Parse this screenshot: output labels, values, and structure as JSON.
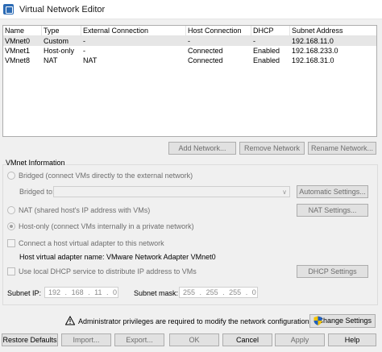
{
  "window": {
    "title": "Virtual Network Editor"
  },
  "table": {
    "columns": [
      "Name",
      "Type",
      "External Connection",
      "Host Connection",
      "DHCP",
      "Subnet Address"
    ],
    "rows": [
      [
        "VMnet0",
        "Custom",
        "-",
        "-",
        "-",
        "192.168.11.0"
      ],
      [
        "VMnet1",
        "Host-only",
        "-",
        "Connected",
        "Enabled",
        "192.168.233.0"
      ],
      [
        "VMnet8",
        "NAT",
        "NAT",
        "Connected",
        "Enabled",
        "192.168.31.0"
      ]
    ]
  },
  "network_buttons": {
    "add": "Add Network...",
    "remove": "Remove Network",
    "rename": "Rename Network..."
  },
  "vmnet_info": {
    "title": "VMnet Information",
    "bridged": {
      "label": "Bridged (connect VMs directly to the external network)",
      "checked": false
    },
    "bridged_to_label": "Bridged to:",
    "bridged_to_value": "",
    "automatic_settings": "Automatic Settings...",
    "nat": {
      "label": "NAT (shared host's IP address with VMs)",
      "checked": false
    },
    "nat_settings": "NAT Settings...",
    "hostonly": {
      "label": "Host-only (connect VMs internally in a private network)",
      "checked": true
    },
    "connect_adapter": {
      "label": "Connect a host virtual adapter to this network",
      "checked": false
    },
    "adapter_name": "Host virtual adapter name: VMware Network Adapter VMnet0",
    "dhcp": {
      "label": "Use local DHCP service to distribute IP address to VMs",
      "checked": false
    },
    "dhcp_settings": "DHCP Settings",
    "subnet_ip_label": "Subnet IP:",
    "subnet_ip": [
      "192",
      "168",
      "11",
      "0"
    ],
    "subnet_mask_label": "Subnet mask:",
    "subnet_mask": [
      "255",
      "255",
      "255",
      "0"
    ]
  },
  "admin": {
    "message": "Administrator privileges are required to modify the network configuration.",
    "change_settings": "Change Settings"
  },
  "footer": {
    "restore": "Restore Defaults",
    "import": "Import...",
    "export": "Export...",
    "ok": "OK",
    "cancel": "Cancel",
    "apply": "Apply",
    "help": "Help"
  },
  "colors": {
    "accent_shield_blue": "#1f5fbf",
    "accent_shield_yellow": "#f2c200",
    "warning": "#000000"
  }
}
